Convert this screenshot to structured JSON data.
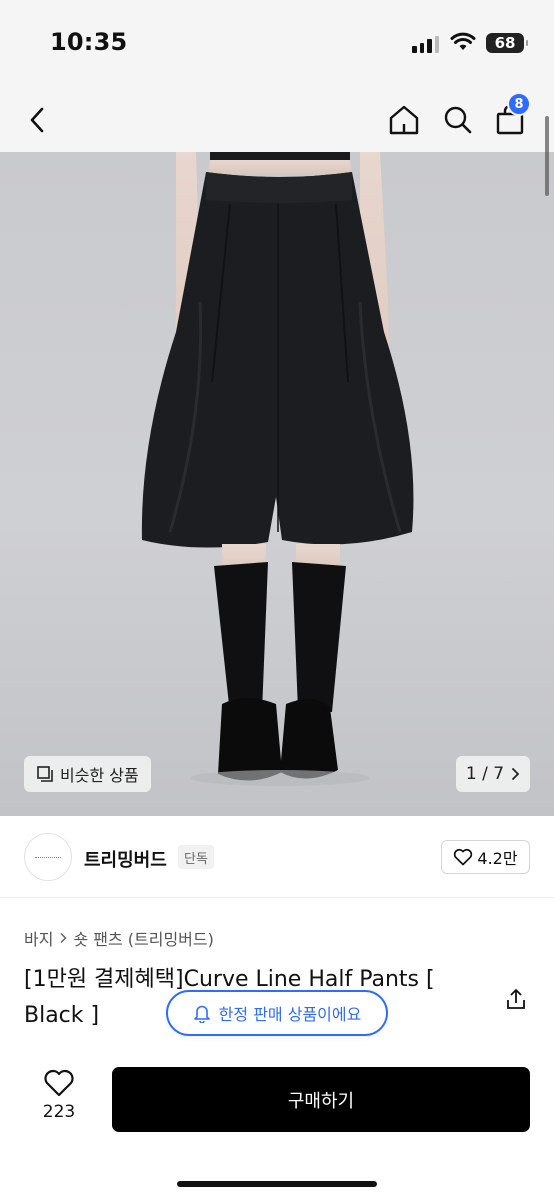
{
  "status": {
    "time": "10:35",
    "battery": "68"
  },
  "nav": {
    "back_icon": "chevron-left-icon",
    "home_icon": "home-icon",
    "search_icon": "search-icon",
    "cart_icon": "shopping-bag-icon",
    "cart_count": "8"
  },
  "gallery": {
    "similar_label": "비슷한 상품",
    "page_indicator": "1 / 7"
  },
  "brand": {
    "name": "트리밍버드",
    "tag": "단독",
    "likes": "4.2만"
  },
  "breadcrumb": {
    "category": "바지",
    "subcategory": "숏 팬츠 (트리밍버드)"
  },
  "product": {
    "title": "[1만원 결제혜택]Curve Line Half Pants [ Black ]",
    "limited_notice": "한정 판매 상품이에요"
  },
  "bottom": {
    "like_count": "223",
    "buy_label": "구매하기"
  },
  "colors": {
    "accent": "#2f6bff",
    "buy_button": "#000000"
  }
}
